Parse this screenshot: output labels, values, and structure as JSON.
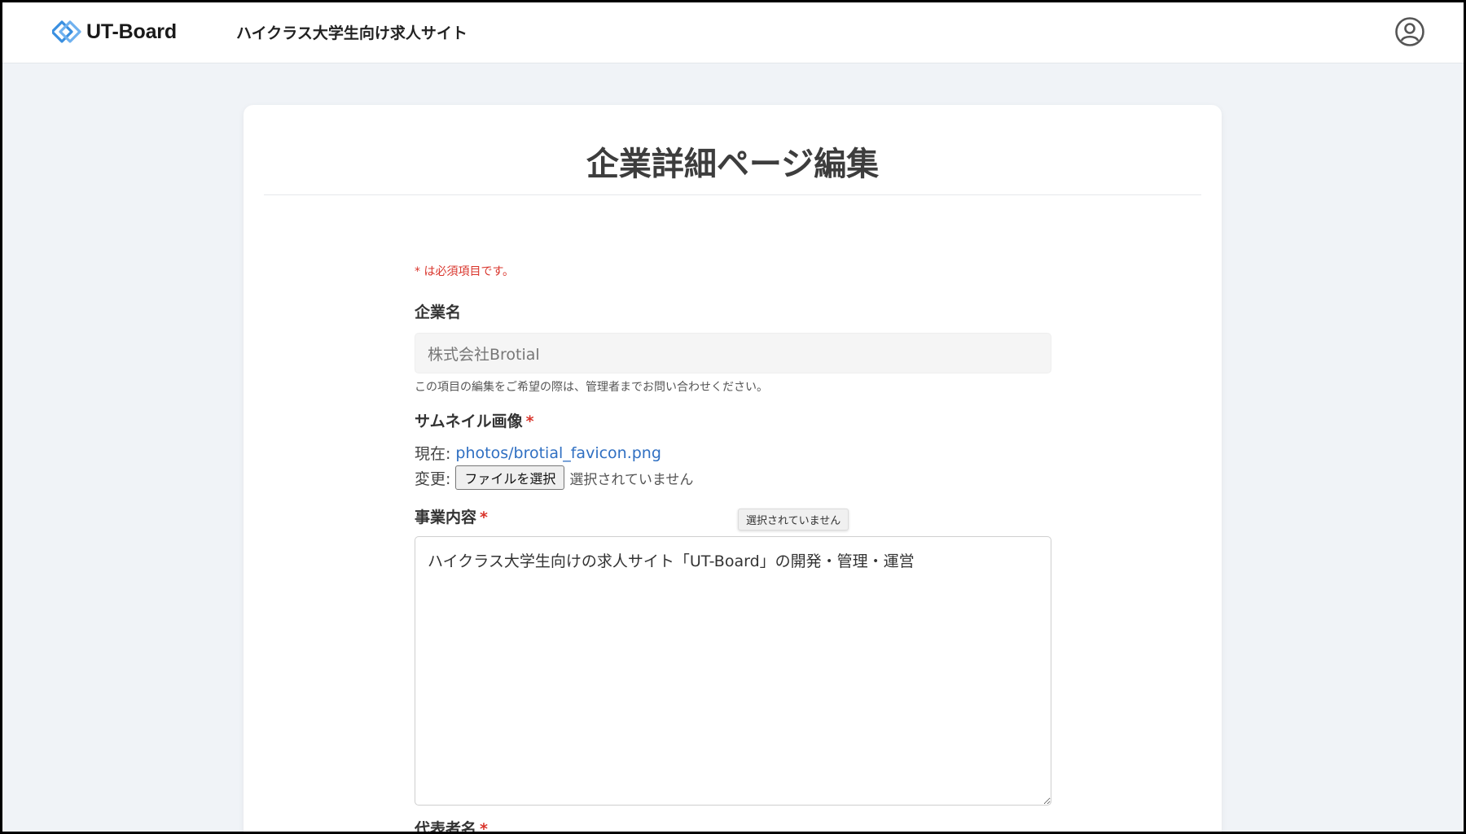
{
  "header": {
    "logo_text": "UT-Board",
    "tagline": "ハイクラス大学生向け求人サイト",
    "brand_color": "#3a8fe0"
  },
  "page": {
    "title": "企業詳細ページ編集",
    "required_note": "* は必須項目です。"
  },
  "form": {
    "company_name": {
      "label": "企業名",
      "value": "株式会社Brotial",
      "help": "この項目の編集をご希望の際は、管理者までお問い合わせください。"
    },
    "thumbnail": {
      "label": "サムネイル画像",
      "required_mark": "*",
      "current_label": "現在:",
      "current_file": "photos/brotial_favicon.png",
      "change_label": "変更:",
      "choose_button": "ファイルを選択",
      "no_file_text": "選択されていません",
      "tooltip": "選択されていません"
    },
    "business": {
      "label": "事業内容",
      "required_mark": "*",
      "value": "ハイクラス大学生向けの求人サイト「UT-Board」の開発・管理・運営"
    },
    "representative": {
      "label": "代表者名",
      "required_mark": "*"
    }
  },
  "colors": {
    "required": "#d9342b",
    "link": "#2f6fc2",
    "background": "#f0f3f7"
  }
}
